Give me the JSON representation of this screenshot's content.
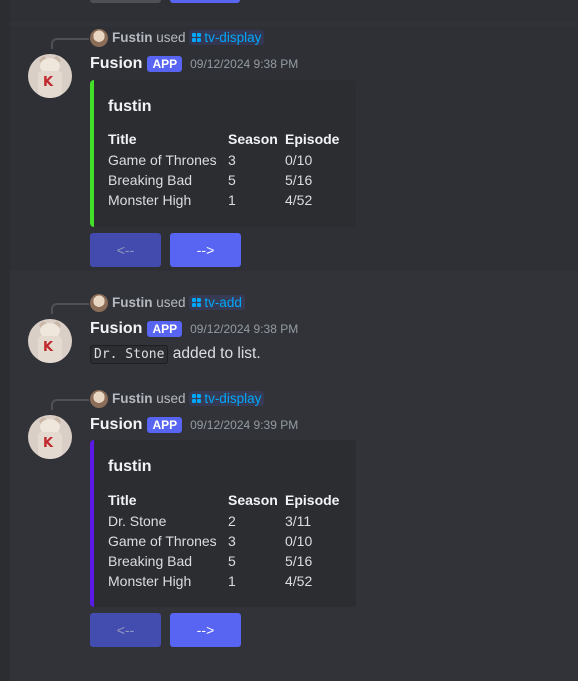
{
  "colors": {
    "accent_green": "#43e02a",
    "accent_purple": "#5a19e6",
    "blurple": "#5865f2",
    "command_blue": "#00a8fc"
  },
  "messages": [
    {
      "reply": {
        "user": "Fustin",
        "used": "used",
        "command": "tv-display"
      },
      "author": "Fusion",
      "badge": "APP",
      "timestamp": "09/12/2024 9:38 PM",
      "embed": {
        "title": "fustin",
        "headers": [
          "Title",
          "Season",
          "Episode"
        ],
        "rows": [
          [
            "Game of Thrones",
            "3",
            "0/10"
          ],
          [
            "Breaking Bad",
            "5",
            "5/16"
          ],
          [
            "Monster High",
            "1",
            "4/52"
          ]
        ]
      },
      "buttons": {
        "prev": "<--",
        "next": "-->"
      }
    },
    {
      "reply": {
        "user": "Fustin",
        "used": "used",
        "command": "tv-add"
      },
      "author": "Fusion",
      "badge": "APP",
      "timestamp": "09/12/2024 9:38 PM",
      "content": {
        "code": "Dr. Stone",
        "text": "added to list."
      }
    },
    {
      "reply": {
        "user": "Fustin",
        "used": "used",
        "command": "tv-display"
      },
      "author": "Fusion",
      "badge": "APP",
      "timestamp": "09/12/2024 9:39 PM",
      "embed": {
        "title": "fustin",
        "headers": [
          "Title",
          "Season",
          "Episode"
        ],
        "rows": [
          [
            "Dr. Stone",
            "2",
            "3/11"
          ],
          [
            "Game of Thrones",
            "3",
            "0/10"
          ],
          [
            "Breaking Bad",
            "5",
            "5/16"
          ],
          [
            "Monster High",
            "1",
            "4/52"
          ]
        ]
      },
      "buttons": {
        "prev": "<--",
        "next": "-->"
      }
    }
  ]
}
